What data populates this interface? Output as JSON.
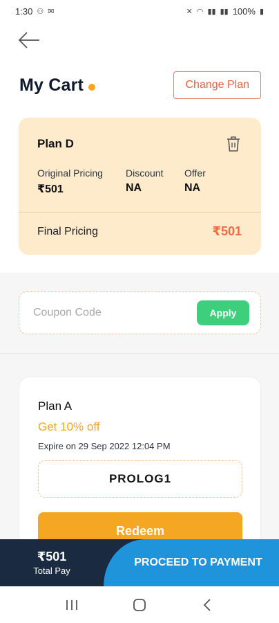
{
  "status_bar": {
    "time": "1:30",
    "battery": "100%"
  },
  "header": {
    "title": "My Cart",
    "change_plan_label": "Change Plan"
  },
  "plan_card": {
    "plan_name": "Plan D",
    "original_pricing_label": "Original Pricing",
    "original_pricing_value": "₹501",
    "discount_label": "Discount",
    "discount_value": "NA",
    "offer_label": "Offer",
    "offer_value": "NA",
    "final_pricing_label": "Final Pricing",
    "final_pricing_value": "₹501"
  },
  "coupon": {
    "placeholder": "Coupon Code",
    "apply_label": "Apply"
  },
  "offer_card": {
    "plan_name": "Plan A",
    "discount_text": "Get 10% off",
    "expiry_text": "Expire on 29 Sep 2022 12:04 PM",
    "code": "PROLOG1",
    "redeem_label": "Redeem"
  },
  "pay_bar": {
    "total_amount": "₹501",
    "total_label": "Total Pay",
    "proceed_label": "PROCEED TO PAYMENT"
  },
  "colors": {
    "accent_orange": "#f5a623",
    "accent_coral": "#ef6a45",
    "apply_green": "#3ecf7d",
    "proceed_blue": "#1f94db",
    "pay_bar_navy": "#1a2a40",
    "plan_card_bg": "#fdebcb"
  },
  "icons": {
    "back": "back-arrow-icon",
    "delete": "trash-icon",
    "nav_recents": "recents-icon",
    "nav_home": "home-icon",
    "nav_back": "nav-back-icon"
  }
}
